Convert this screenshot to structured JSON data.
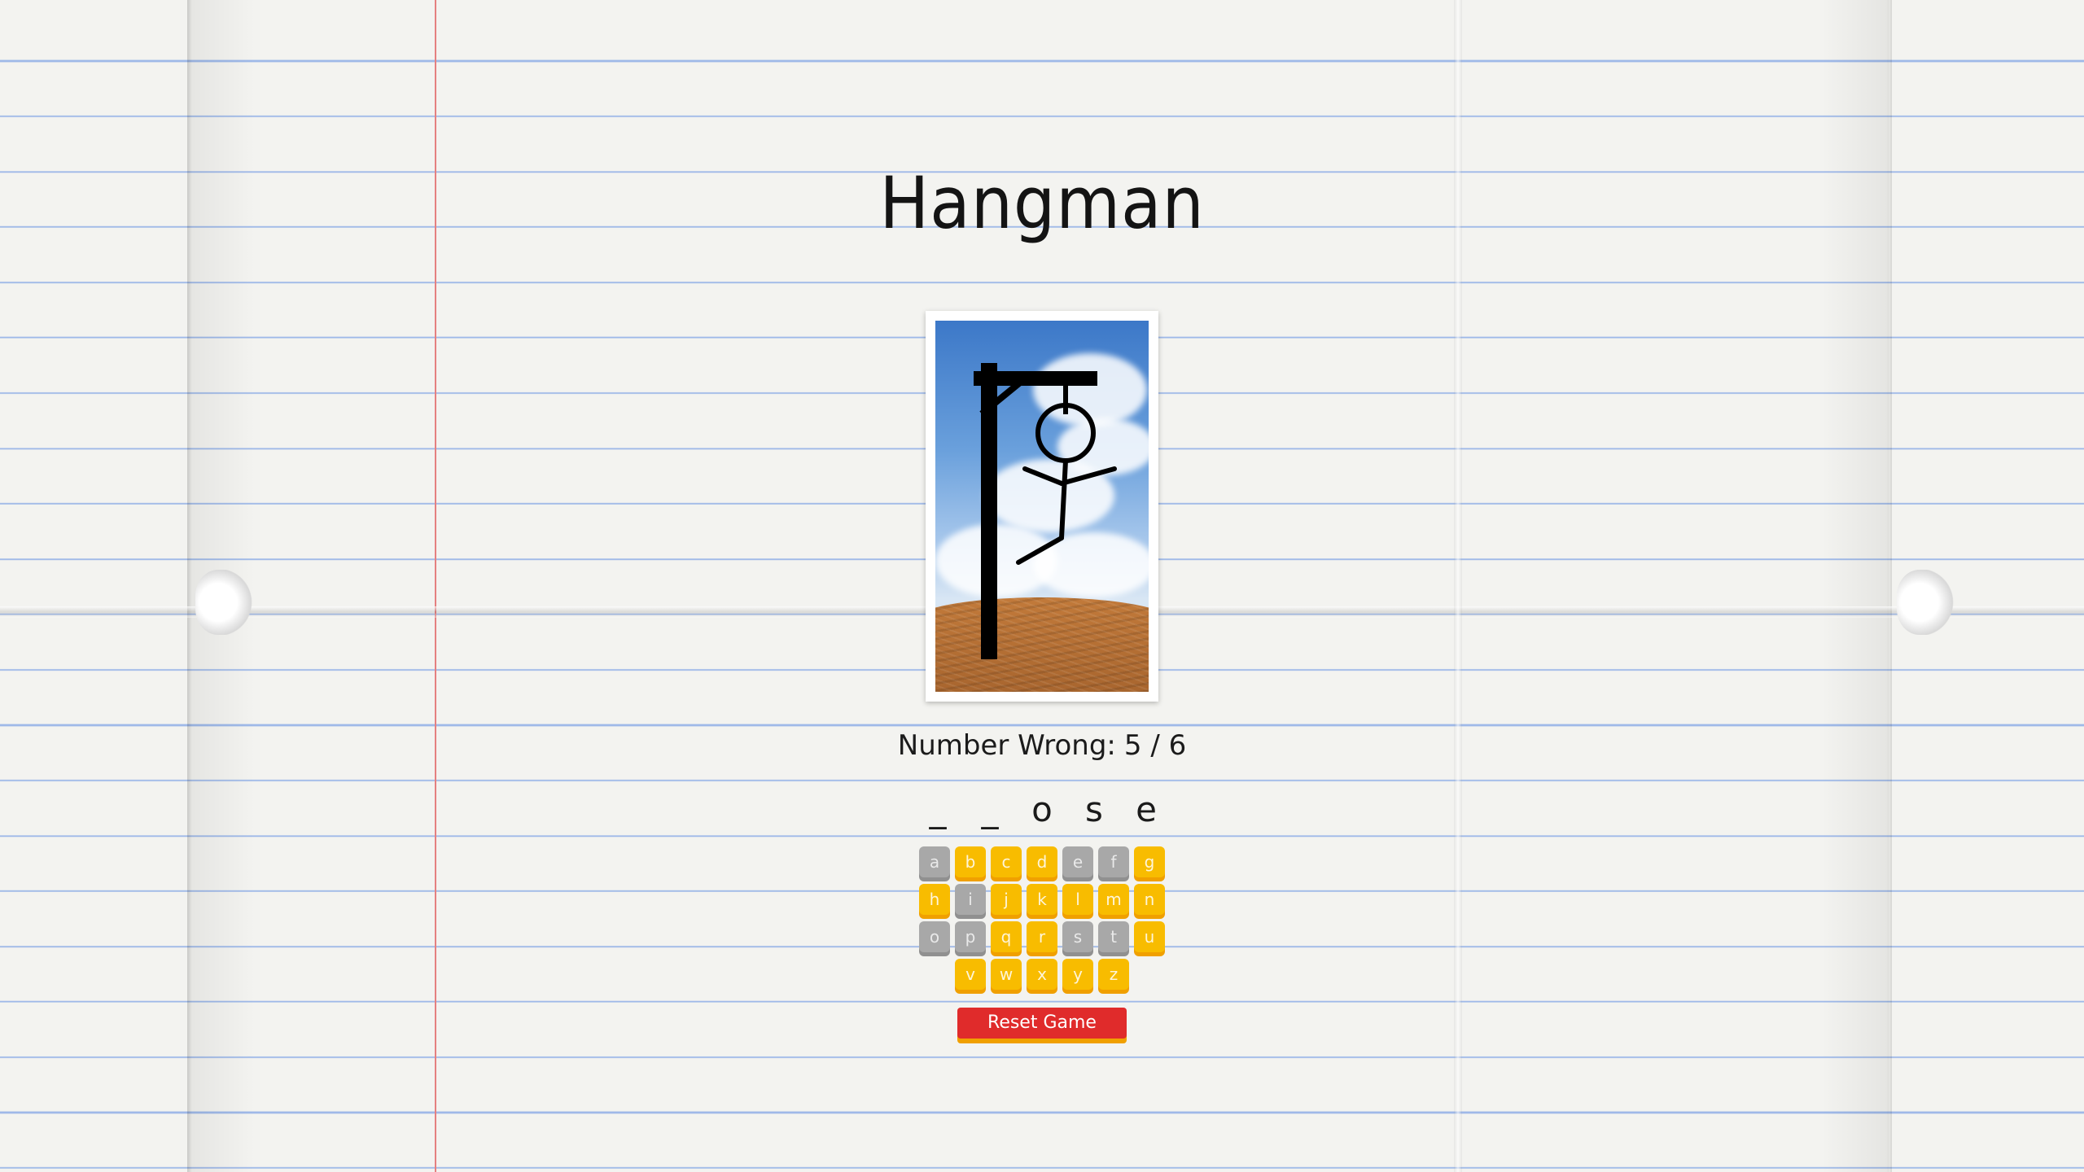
{
  "app": {
    "title": "Hangman"
  },
  "status": {
    "wrong_label": "Number Wrong:",
    "wrong_value": "5 / 6"
  },
  "word": [
    "_",
    "_",
    "o",
    "s",
    "e"
  ],
  "keyboard": {
    "rows": [
      [
        {
          "letter": "a",
          "used": true
        },
        {
          "letter": "b",
          "used": false
        },
        {
          "letter": "c",
          "used": false
        },
        {
          "letter": "d",
          "used": false
        },
        {
          "letter": "e",
          "used": true
        },
        {
          "letter": "f",
          "used": true
        },
        {
          "letter": "g",
          "used": false
        }
      ],
      [
        {
          "letter": "h",
          "used": false
        },
        {
          "letter": "i",
          "used": true
        },
        {
          "letter": "j",
          "used": false
        },
        {
          "letter": "k",
          "used": false
        },
        {
          "letter": "l",
          "used": false
        },
        {
          "letter": "m",
          "used": false
        },
        {
          "letter": "n",
          "used": false
        }
      ],
      [
        {
          "letter": "o",
          "used": true
        },
        {
          "letter": "p",
          "used": true
        },
        {
          "letter": "q",
          "used": false
        },
        {
          "letter": "r",
          "used": false
        },
        {
          "letter": "s",
          "used": true
        },
        {
          "letter": "t",
          "used": true
        },
        {
          "letter": "u",
          "used": false
        }
      ],
      [
        {
          "letter": "v",
          "used": false
        },
        {
          "letter": "w",
          "used": false
        },
        {
          "letter": "x",
          "used": false
        },
        {
          "letter": "y",
          "used": false
        },
        {
          "letter": "z",
          "used": false
        }
      ]
    ]
  },
  "reset_label": "Reset Game",
  "colors": {
    "key_active": "#f8bc00",
    "key_used": "#a8a8a8",
    "reset_button": "#e02b2b"
  }
}
